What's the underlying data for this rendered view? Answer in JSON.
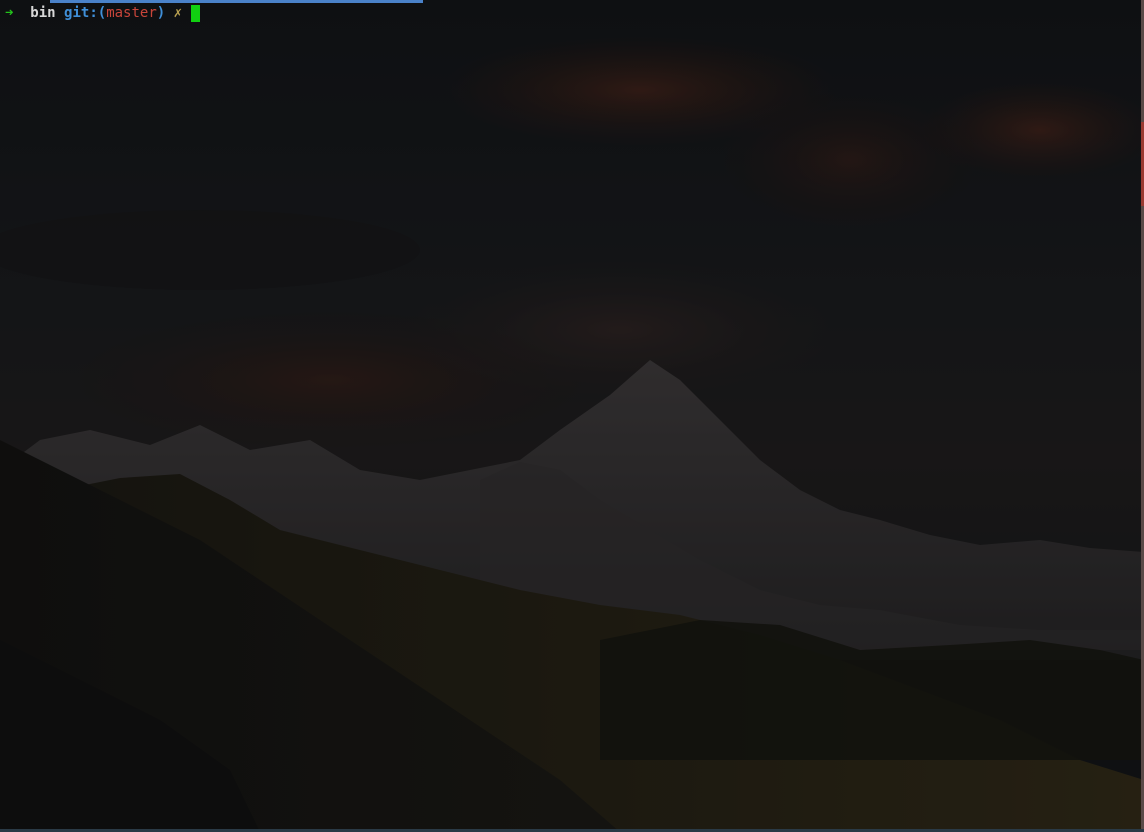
{
  "terminal": {
    "prompt_arrow": "➜",
    "cwd": "bin",
    "git_label": "git:",
    "paren_open": "(",
    "branch": "master",
    "paren_close": ")",
    "dirty_marker": "✗"
  },
  "colors": {
    "arrow": "#23c21b",
    "git": "#3f8fd8",
    "branch": "#c8453a",
    "cursor": "#11d011",
    "progress_bar": "#4a82c9"
  },
  "icons": {
    "cursor": "block-cursor-icon",
    "arrow": "prompt-arrow-icon"
  }
}
